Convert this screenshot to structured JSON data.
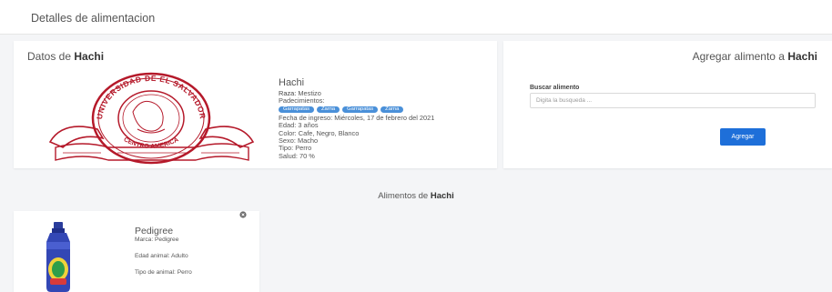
{
  "header": {
    "title": "Detalles de alimentacion"
  },
  "pet_card": {
    "title_prefix": "Datos de",
    "pet_name": "Hachi",
    "seal_text": [
      "UNIVERSIDAD DE EL SALVADOR",
      "CENTRO AMERICA"
    ],
    "info": {
      "name": "Hachi",
      "raza_label": "Raza:",
      "raza": "Mestizo",
      "padecimientos_label": "Padecimientos:",
      "padecimientos": [
        "Garrapatas",
        "Zarna",
        "Garrapatas",
        "Zarna"
      ],
      "fecha_label": "Fecha de ingreso:",
      "fecha": "Miércoles, 17 de febrero del 2021",
      "edad_label": "Edad:",
      "edad": "3 años",
      "color_label": "Color:",
      "color": "Cafe, Negro, Blanco",
      "sexo_label": "Sexo:",
      "sexo": "Macho",
      "tipo_label": "Tipo:",
      "tipo": "Perro",
      "salud_label": "Salud:",
      "salud": "70 %"
    }
  },
  "add_food": {
    "title_prefix": "Agregar alimento a",
    "pet_name": "Hachi",
    "search_label": "Buscar alimento",
    "search_placeholder": "Digita la busqueda ...",
    "button_label": "Agregar"
  },
  "foods_section": {
    "title_prefix": "Alimentos de",
    "pet_name": "Hachi",
    "items": [
      {
        "name": "Pedigree",
        "marca_label": "Marca:",
        "marca": "Pedigree",
        "edad_label": "Edad animal:",
        "edad": "Adulto",
        "tipo_label": "Tipo de animal:",
        "tipo": "Perro"
      }
    ]
  },
  "colors": {
    "accent": "#1e6fd9",
    "badge": "#4a90d9",
    "seal": "#b5192a"
  }
}
